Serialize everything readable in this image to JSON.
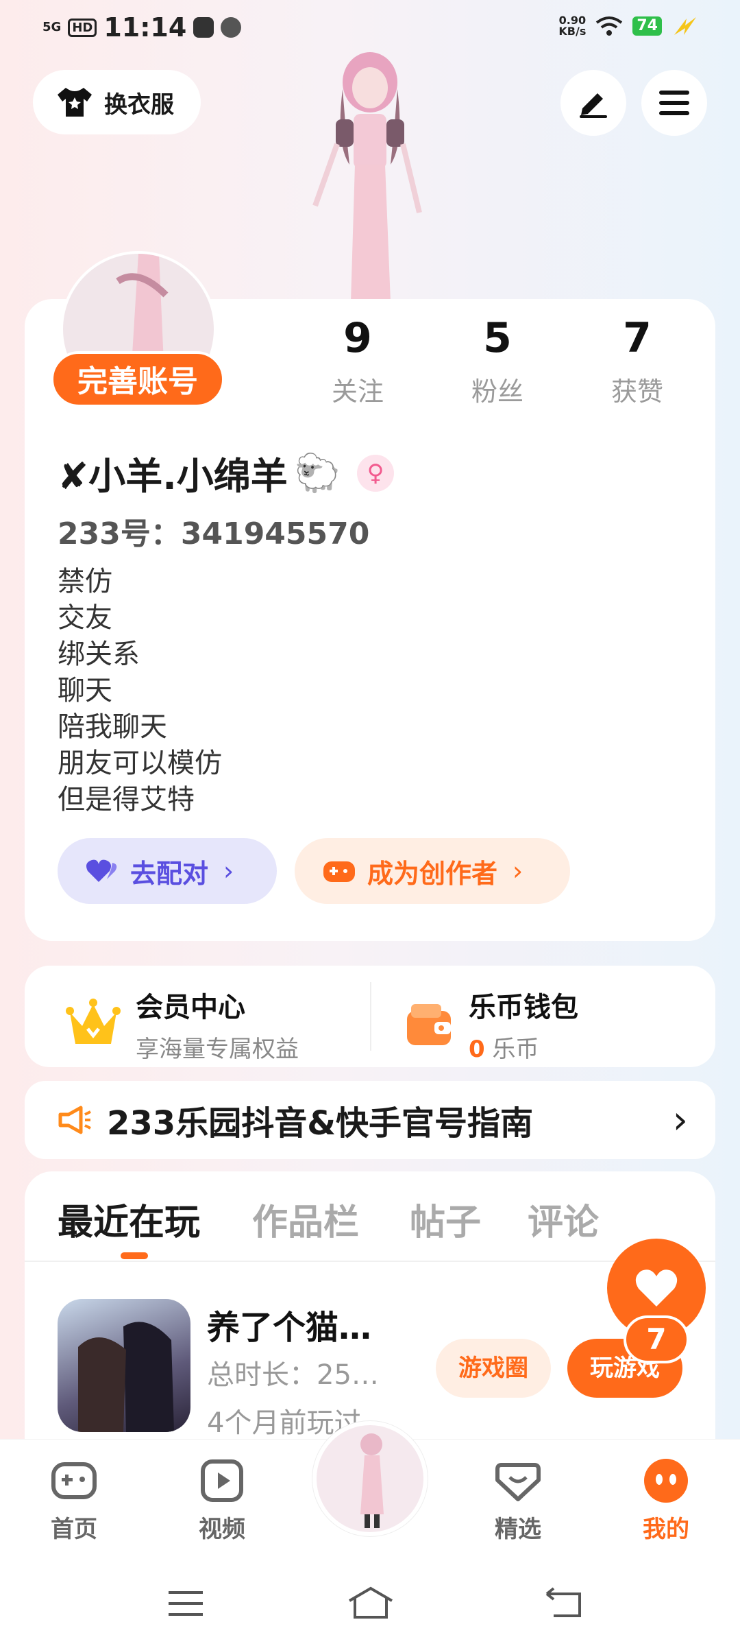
{
  "status_bar": {
    "time": "11:14",
    "network": "5G",
    "hd": "HD",
    "speed": "0.90",
    "speed_unit": "KB/s",
    "battery": "74"
  },
  "header": {
    "outfit_label": "换衣服"
  },
  "profile": {
    "complete_label": "完善账号",
    "stats": [
      {
        "value": "9",
        "label": "关注"
      },
      {
        "value": "5",
        "label": "粉丝"
      },
      {
        "value": "7",
        "label": "获赞"
      }
    ],
    "nickname": "✘小羊.小绵羊",
    "nickname_emoji": "🐑",
    "gender_symbol": "♀",
    "uid": "233号：341945570",
    "bio": [
      "禁仿",
      "交友",
      "绑关系",
      "聊天",
      "陪我聊天",
      "朋友可以模仿",
      "但是得艾特"
    ],
    "match_label": "去配对",
    "creator_label": "成为创作者",
    "chevron": "›"
  },
  "member": {
    "title": "会员中心",
    "subtitle": "享海量专属权益"
  },
  "wallet": {
    "title": "乐币钱包",
    "amount": "0",
    "unit": "乐币"
  },
  "notice": {
    "text": "233乐园抖音&快手官号指南",
    "chevron": "›"
  },
  "tabs": [
    "最近在玩",
    "作品栏",
    "帖子",
    "评论"
  ],
  "recent_game": {
    "name": "养了个猫…",
    "duration": "总时长：25…",
    "last_played": "4个月前玩过",
    "circle_label": "游戏圈",
    "play_label": "玩游戏"
  },
  "like_count": "7",
  "nav": [
    {
      "label": "首页",
      "icon": "gamepad-icon"
    },
    {
      "label": "视频",
      "icon": "video-icon"
    },
    {
      "label": "精选",
      "icon": "heart-chat-icon"
    },
    {
      "label": "我的",
      "icon": "face-icon"
    }
  ],
  "colors": {
    "accent": "#ff6a1a",
    "purple": "#5a4fe0",
    "bg_card": "#ffffff"
  }
}
